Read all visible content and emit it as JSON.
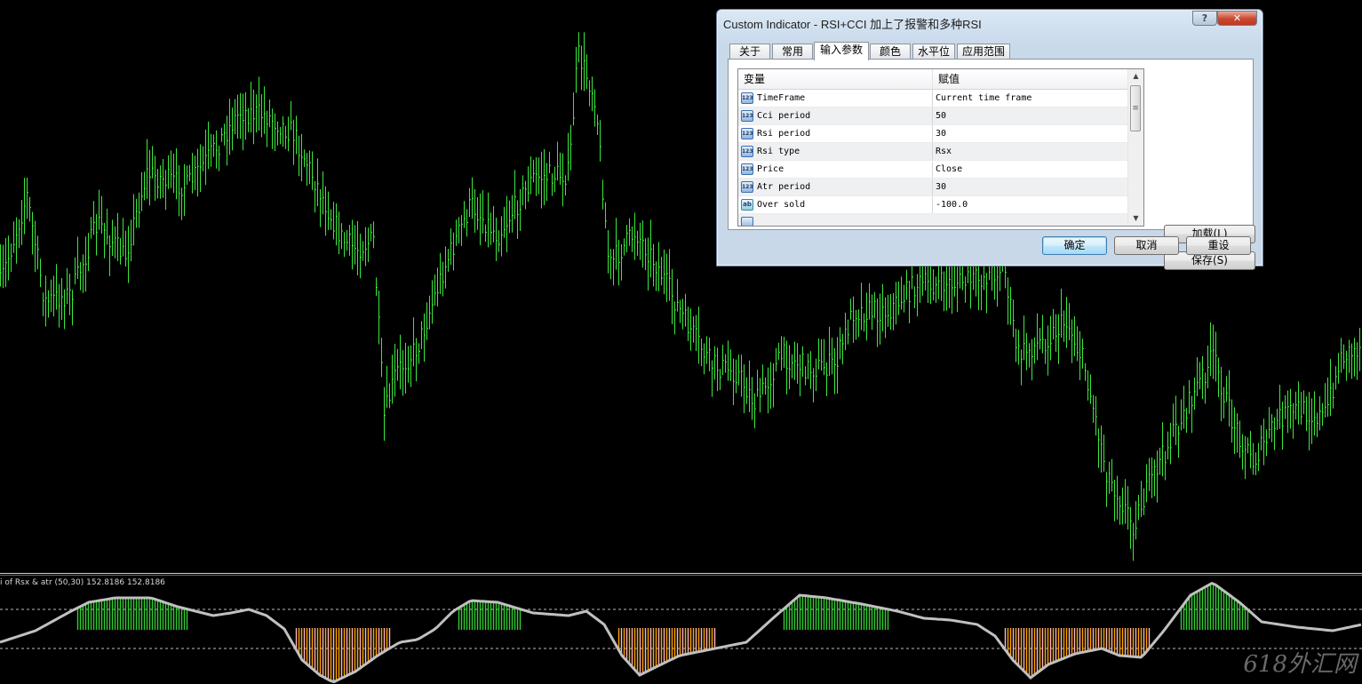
{
  "colors": {
    "background": "#000000",
    "candles": "#3be83b",
    "osc_line": "#c0c0c0",
    "osc_level": "#bdbdbd",
    "hist_green": "#32cd32",
    "hist_orange": "#ffa500",
    "hist_pink": "#ffb6c1"
  },
  "indicator_label": "i of Rsx & atr (50,30) 152.8186 152.8186",
  "watermark": "618外汇网",
  "dialog": {
    "title": "Custom Indicator - RSI+CCI 加上了报警和多种RSI",
    "help_icon": "?",
    "close_icon": "✕",
    "tabs": [
      "关于",
      "常用",
      "输入参数",
      "颜色",
      "水平位",
      "应用范围"
    ],
    "active_tab": "输入参数",
    "columns": {
      "variable": "变量",
      "value": "赋值"
    },
    "params": [
      {
        "icon": "123",
        "name": "TimeFrame",
        "value": "Current time frame"
      },
      {
        "icon": "123",
        "name": "Cci period",
        "value": "50"
      },
      {
        "icon": "123",
        "name": "Rsi period",
        "value": "30"
      },
      {
        "icon": "123",
        "name": "Rsi type",
        "value": "Rsx"
      },
      {
        "icon": "123",
        "name": "Price",
        "value": "Close"
      },
      {
        "icon": "123",
        "name": "Atr period",
        "value": "30"
      },
      {
        "icon": "ab",
        "name": "Over sold",
        "value": "-100.0"
      }
    ],
    "buttons": {
      "load": "加载(L)",
      "save": "保存(S)",
      "ok": "确定",
      "cancel": "取消",
      "reset": "重设"
    }
  }
}
